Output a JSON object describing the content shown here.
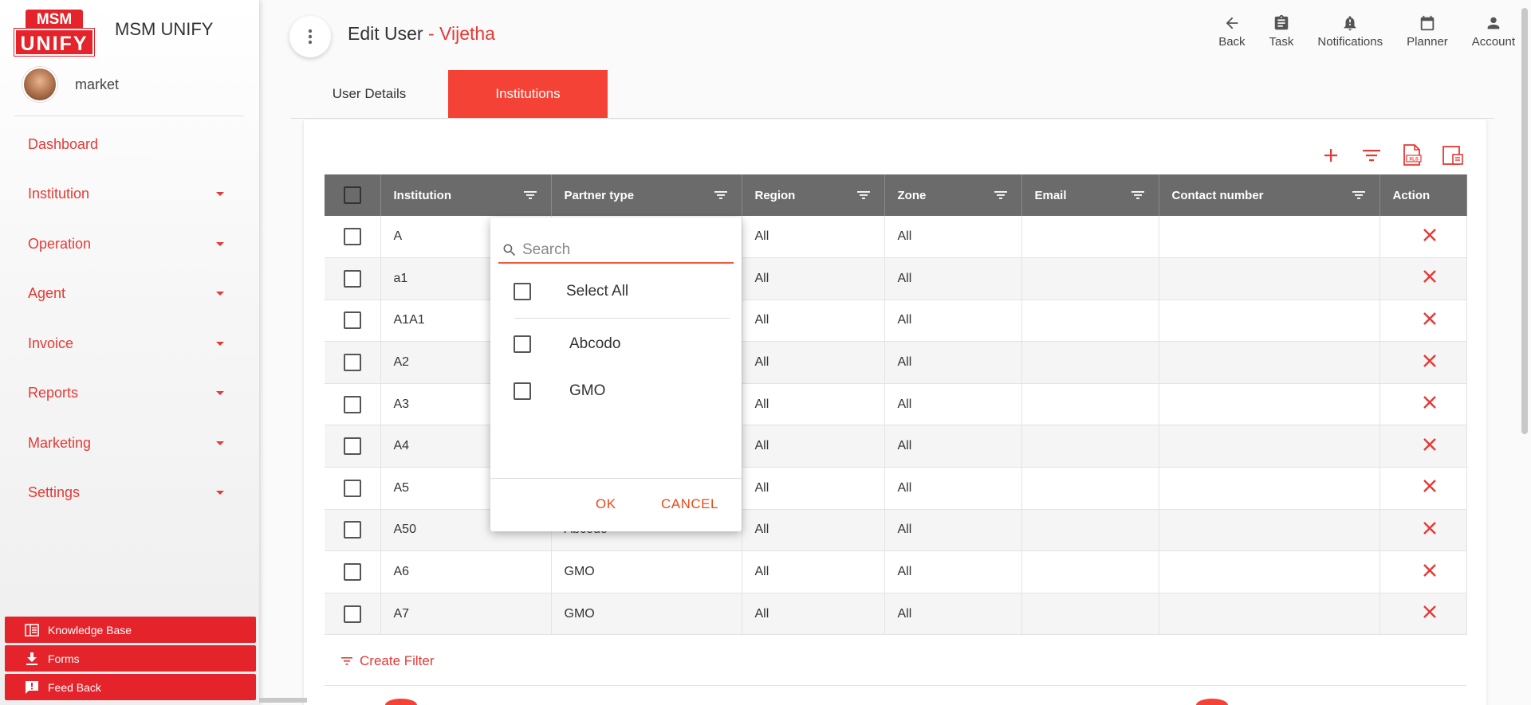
{
  "brand": {
    "logo_top": "MSM",
    "logo_bottom": "UNIFY",
    "app_name": "MSM UNIFY"
  },
  "user": {
    "name": "market"
  },
  "nav": [
    {
      "label": "Dashboard",
      "has_caret": false
    },
    {
      "label": "Institution",
      "has_caret": true
    },
    {
      "label": "Operation",
      "has_caret": true
    },
    {
      "label": "Agent",
      "has_caret": true
    },
    {
      "label": "Invoice",
      "has_caret": true
    },
    {
      "label": "Reports",
      "has_caret": true
    },
    {
      "label": "Marketing",
      "has_caret": true
    },
    {
      "label": "Settings",
      "has_caret": true
    }
  ],
  "footer": {
    "knowledge": "Knowledge Base",
    "forms": "Forms",
    "feedback": "Feed Back"
  },
  "header": {
    "title": "Edit User",
    "separator": " - ",
    "user_name": "Vijetha"
  },
  "top_actions": {
    "back": "Back",
    "task": "Task",
    "notifications": "Notifications",
    "planner": "Planner",
    "account": "Account"
  },
  "tabs": {
    "user_details": "User Details",
    "institutions": "Institutions"
  },
  "table": {
    "headers": [
      "Institution",
      "Partner type",
      "Region",
      "Zone",
      "Email",
      "Contact number",
      "Action"
    ],
    "rows": [
      {
        "institution": "A",
        "partner": "",
        "region": "All",
        "zone": "All",
        "email": "",
        "contact": ""
      },
      {
        "institution": "a1",
        "partner": "",
        "region": "All",
        "zone": "All",
        "email": "",
        "contact": ""
      },
      {
        "institution": "A1A1",
        "partner": "",
        "region": "All",
        "zone": "All",
        "email": "",
        "contact": ""
      },
      {
        "institution": "A2",
        "partner": "",
        "region": "All",
        "zone": "All",
        "email": "",
        "contact": ""
      },
      {
        "institution": "A3",
        "partner": "",
        "region": "All",
        "zone": "All",
        "email": "",
        "contact": ""
      },
      {
        "institution": "A4",
        "partner": "",
        "region": "All",
        "zone": "All",
        "email": "",
        "contact": ""
      },
      {
        "institution": "A5",
        "partner": "",
        "region": "All",
        "zone": "All",
        "email": "",
        "contact": ""
      },
      {
        "institution": "A50",
        "partner": "Abcodo",
        "region": "All",
        "zone": "All",
        "email": "",
        "contact": ""
      },
      {
        "institution": "A6",
        "partner": "GMO",
        "region": "All",
        "zone": "All",
        "email": "",
        "contact": ""
      },
      {
        "institution": "A7",
        "partner": "GMO",
        "region": "All",
        "zone": "All",
        "email": "",
        "contact": ""
      }
    ],
    "create_filter": "Create Filter"
  },
  "popup": {
    "search_placeholder": "Search",
    "select_all": "Select All",
    "options": [
      "Abcodo",
      "GMO"
    ],
    "ok": "OK",
    "cancel": "CANCEL"
  },
  "colors": {
    "accent": "#e53935",
    "header_bg": "#6b6b6b",
    "tab_active": "#f44336"
  }
}
